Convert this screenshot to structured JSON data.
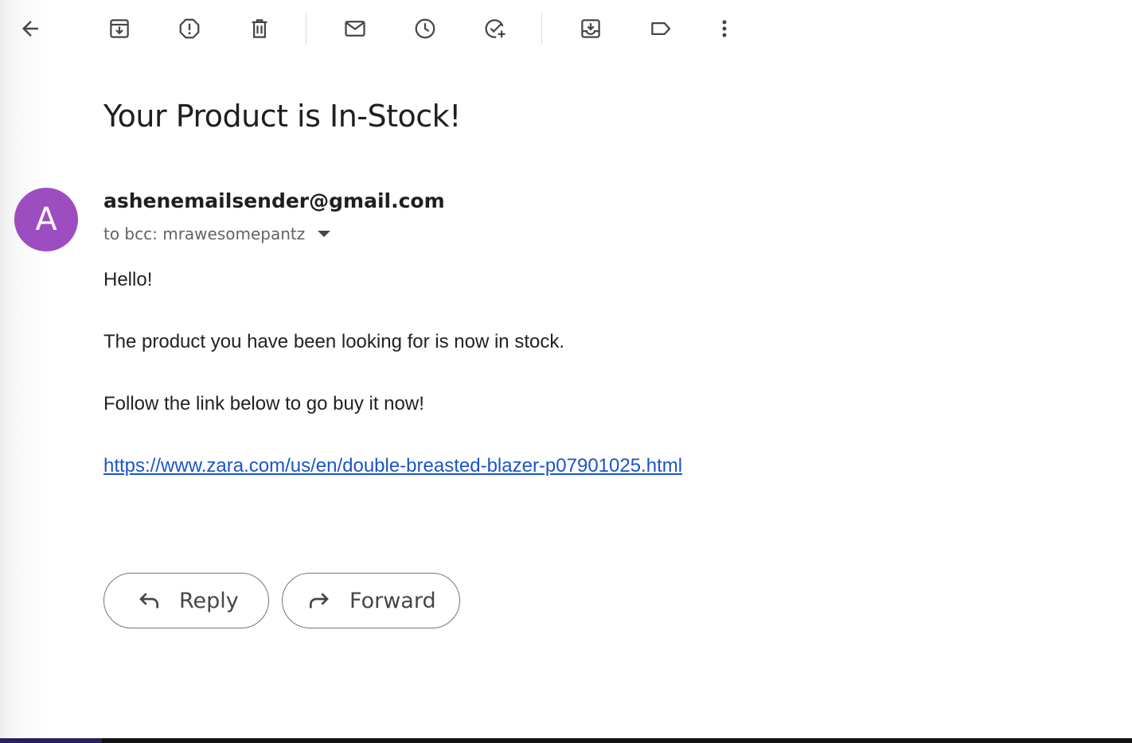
{
  "toolbar": {
    "buttons": [
      {
        "name": "back",
        "icon": "arrow-left-icon",
        "label": "Back"
      },
      {
        "name": "archive",
        "icon": "archive-icon",
        "label": "Archive"
      },
      {
        "name": "report-spam",
        "icon": "report-spam-icon",
        "label": "Report spam"
      },
      {
        "name": "delete",
        "icon": "trash-icon",
        "label": "Delete"
      },
      {
        "name": "mark-unread",
        "icon": "mail-icon",
        "label": "Mark as unread"
      },
      {
        "name": "snooze",
        "icon": "clock-icon",
        "label": "Snooze"
      },
      {
        "name": "add-to-tasks",
        "icon": "add-task-icon",
        "label": "Add to Tasks"
      },
      {
        "name": "move-to",
        "icon": "move-to-icon",
        "label": "Move to"
      },
      {
        "name": "labels",
        "icon": "label-icon",
        "label": "Labels"
      },
      {
        "name": "more",
        "icon": "more-vert-icon",
        "label": "More"
      }
    ]
  },
  "email": {
    "subject": "Your Product is In-Stock!",
    "avatar_letter": "A",
    "avatar_color": "#9c4dc0",
    "sender": "ashenemailsender@gmail.com",
    "recipient": "to bcc: mrawesomepantz",
    "body": {
      "greeting": "Hello!",
      "line1": "The product you have been looking for is now in stock.",
      "line2": "Follow the link below to go buy it now!",
      "link": "https://www.zara.com/us/en/double-breasted-blazer-p07901025.html"
    }
  },
  "actions": {
    "reply_label": "Reply",
    "forward_label": "Forward"
  },
  "colors": {
    "link": "#1a55c8",
    "icon": "#444746"
  }
}
